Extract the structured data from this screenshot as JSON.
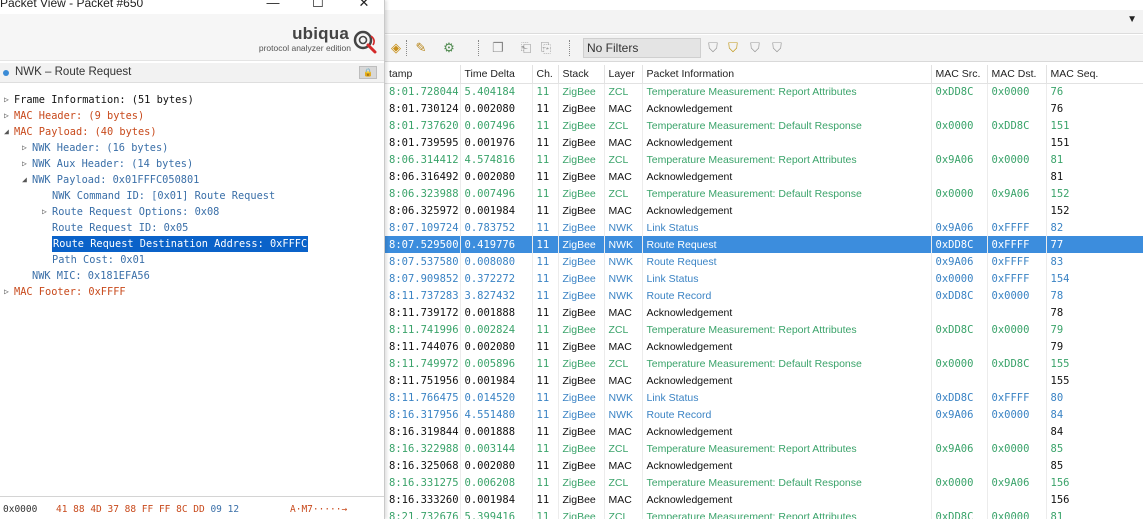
{
  "packet_view": {
    "title": "Packet View - Packet #650",
    "minimize_glyph": "—",
    "maximize_glyph": "☐",
    "close_glyph": "✕",
    "logo_text": "ubiqua",
    "logo_subtitle": "protocol analyzer edition",
    "subtitle": "NWK – Route Request",
    "tree": [
      {
        "indent": 0,
        "arrow": "▷",
        "label": "Frame Information: (51 bytes)",
        "color": "black"
      },
      {
        "indent": 0,
        "arrow": "▷",
        "label": "MAC Header: (9 bytes)",
        "color": "red"
      },
      {
        "indent": 0,
        "arrow": "◢",
        "label": "MAC Payload: (40 bytes)",
        "color": "red"
      },
      {
        "indent": 1,
        "arrow": "▷",
        "label": "NWK Header: (16 bytes)",
        "color": "blue"
      },
      {
        "indent": 1,
        "arrow": "▷",
        "label": "NWK Aux Header: (14 bytes)",
        "color": "blue"
      },
      {
        "indent": 1,
        "arrow": "◢",
        "label": "NWK Payload: 0x01FFFC050801",
        "color": "blue"
      },
      {
        "indent": 2,
        "arrow": "",
        "label": "NWK Command ID: [0x01] Route Request",
        "color": "blue"
      },
      {
        "indent": 2,
        "arrow": "▷",
        "label": "Route Request Options: 0x08",
        "color": "blue"
      },
      {
        "indent": 2,
        "arrow": "",
        "label": "Route Request ID: 0x05",
        "color": "blue"
      },
      {
        "indent": 2,
        "arrow": "",
        "label": "Route Request Destination Address: 0xFFFC",
        "color": "blue",
        "selected": true
      },
      {
        "indent": 2,
        "arrow": "",
        "label": "Path Cost: 0x01",
        "color": "blue"
      },
      {
        "indent": 1,
        "arrow": "",
        "label": "NWK MIC: 0x181EFA56",
        "color": "blue"
      },
      {
        "indent": 0,
        "arrow": "▷",
        "label": "MAC Footer: 0xFFFF",
        "color": "red"
      }
    ],
    "hex": {
      "offset": "0x0000",
      "bytes_red": "41 88 4D 37 88 FF FF 8C DD",
      "bytes_blue": "09 12",
      "ascii": "A·M7·····→"
    }
  },
  "toolbar": {
    "filter_text": "No Filters"
  },
  "packet_table": {
    "columns": [
      "tamp",
      "Time Delta",
      "Ch.",
      "Stack",
      "Layer",
      "Packet Information",
      "MAC Src.",
      "MAC Dst.",
      "MAC Seq."
    ],
    "rows": [
      {
        "ts": "8:01.728044",
        "delta": "5.404184",
        "ch": "11",
        "stack": "ZigBee",
        "layer": "ZCL",
        "info": "Temperature Measurement: Report Attributes",
        "src": "0xDD8C",
        "dst": "0x0000",
        "seq": "76",
        "kind": "zcl"
      },
      {
        "ts": "8:01.730124",
        "delta": "0.002080",
        "ch": "11",
        "stack": "ZigBee",
        "layer": "MAC",
        "info": "Acknowledgement",
        "src": "",
        "dst": "",
        "seq": "76",
        "kind": "mac"
      },
      {
        "ts": "8:01.737620",
        "delta": "0.007496",
        "ch": "11",
        "stack": "ZigBee",
        "layer": "ZCL",
        "info": "Temperature Measurement: Default Response",
        "src": "0x0000",
        "dst": "0xDD8C",
        "seq": "151",
        "kind": "zcl"
      },
      {
        "ts": "8:01.739595",
        "delta": "0.001976",
        "ch": "11",
        "stack": "ZigBee",
        "layer": "MAC",
        "info": "Acknowledgement",
        "src": "",
        "dst": "",
        "seq": "151",
        "kind": "mac"
      },
      {
        "ts": "8:06.314412",
        "delta": "4.574816",
        "ch": "11",
        "stack": "ZigBee",
        "layer": "ZCL",
        "info": "Temperature Measurement: Report Attributes",
        "src": "0x9A06",
        "dst": "0x0000",
        "seq": "81",
        "kind": "zcl"
      },
      {
        "ts": "8:06.316492",
        "delta": "0.002080",
        "ch": "11",
        "stack": "ZigBee",
        "layer": "MAC",
        "info": "Acknowledgement",
        "src": "",
        "dst": "",
        "seq": "81",
        "kind": "mac"
      },
      {
        "ts": "8:06.323988",
        "delta": "0.007496",
        "ch": "11",
        "stack": "ZigBee",
        "layer": "ZCL",
        "info": "Temperature Measurement: Default Response",
        "src": "0x0000",
        "dst": "0x9A06",
        "seq": "152",
        "kind": "zcl"
      },
      {
        "ts": "8:06.325972",
        "delta": "0.001984",
        "ch": "11",
        "stack": "ZigBee",
        "layer": "MAC",
        "info": "Acknowledgement",
        "src": "",
        "dst": "",
        "seq": "152",
        "kind": "mac"
      },
      {
        "ts": "8:07.109724",
        "delta": "0.783752",
        "ch": "11",
        "stack": "ZigBee",
        "layer": "NWK",
        "info": "Link Status",
        "src": "0x9A06",
        "dst": "0xFFFF",
        "seq": "82",
        "kind": "nwk"
      },
      {
        "ts": "8:07.529500",
        "delta": "0.419776",
        "ch": "11",
        "stack": "ZigBee",
        "layer": "NWK",
        "info": "Route Request",
        "src": "0xDD8C",
        "dst": "0xFFFF",
        "seq": "77",
        "kind": "nwk",
        "selected": true
      },
      {
        "ts": "8:07.537580",
        "delta": "0.008080",
        "ch": "11",
        "stack": "ZigBee",
        "layer": "NWK",
        "info": "Route Request",
        "src": "0x9A06",
        "dst": "0xFFFF",
        "seq": "83",
        "kind": "nwk"
      },
      {
        "ts": "8:07.909852",
        "delta": "0.372272",
        "ch": "11",
        "stack": "ZigBee",
        "layer": "NWK",
        "info": "Link Status",
        "src": "0x0000",
        "dst": "0xFFFF",
        "seq": "154",
        "kind": "nwk"
      },
      {
        "ts": "8:11.737283",
        "delta": "3.827432",
        "ch": "11",
        "stack": "ZigBee",
        "layer": "NWK",
        "info": "Route Record",
        "src": "0xDD8C",
        "dst": "0x0000",
        "seq": "78",
        "kind": "nwk"
      },
      {
        "ts": "8:11.739172",
        "delta": "0.001888",
        "ch": "11",
        "stack": "ZigBee",
        "layer": "MAC",
        "info": "Acknowledgement",
        "src": "",
        "dst": "",
        "seq": "78",
        "kind": "mac"
      },
      {
        "ts": "8:11.741996",
        "delta": "0.002824",
        "ch": "11",
        "stack": "ZigBee",
        "layer": "ZCL",
        "info": "Temperature Measurement: Report Attributes",
        "src": "0xDD8C",
        "dst": "0x0000",
        "seq": "79",
        "kind": "zcl"
      },
      {
        "ts": "8:11.744076",
        "delta": "0.002080",
        "ch": "11",
        "stack": "ZigBee",
        "layer": "MAC",
        "info": "Acknowledgement",
        "src": "",
        "dst": "",
        "seq": "79",
        "kind": "mac"
      },
      {
        "ts": "8:11.749972",
        "delta": "0.005896",
        "ch": "11",
        "stack": "ZigBee",
        "layer": "ZCL",
        "info": "Temperature Measurement: Default Response",
        "src": "0x0000",
        "dst": "0xDD8C",
        "seq": "155",
        "kind": "zcl"
      },
      {
        "ts": "8:11.751956",
        "delta": "0.001984",
        "ch": "11",
        "stack": "ZigBee",
        "layer": "MAC",
        "info": "Acknowledgement",
        "src": "",
        "dst": "",
        "seq": "155",
        "kind": "mac"
      },
      {
        "ts": "8:11.766475",
        "delta": "0.014520",
        "ch": "11",
        "stack": "ZigBee",
        "layer": "NWK",
        "info": "Link Status",
        "src": "0xDD8C",
        "dst": "0xFFFF",
        "seq": "80",
        "kind": "nwk"
      },
      {
        "ts": "8:16.317956",
        "delta": "4.551480",
        "ch": "11",
        "stack": "ZigBee",
        "layer": "NWK",
        "info": "Route Record",
        "src": "0x9A06",
        "dst": "0x0000",
        "seq": "84",
        "kind": "nwk"
      },
      {
        "ts": "8:16.319844",
        "delta": "0.001888",
        "ch": "11",
        "stack": "ZigBee",
        "layer": "MAC",
        "info": "Acknowledgement",
        "src": "",
        "dst": "",
        "seq": "84",
        "kind": "mac"
      },
      {
        "ts": "8:16.322988",
        "delta": "0.003144",
        "ch": "11",
        "stack": "ZigBee",
        "layer": "ZCL",
        "info": "Temperature Measurement: Report Attributes",
        "src": "0x9A06",
        "dst": "0x0000",
        "seq": "85",
        "kind": "zcl"
      },
      {
        "ts": "8:16.325068",
        "delta": "0.002080",
        "ch": "11",
        "stack": "ZigBee",
        "layer": "MAC",
        "info": "Acknowledgement",
        "src": "",
        "dst": "",
        "seq": "85",
        "kind": "mac"
      },
      {
        "ts": "8:16.331275",
        "delta": "0.006208",
        "ch": "11",
        "stack": "ZigBee",
        "layer": "ZCL",
        "info": "Temperature Measurement: Default Response",
        "src": "0x0000",
        "dst": "0x9A06",
        "seq": "156",
        "kind": "zcl"
      },
      {
        "ts": "8:16.333260",
        "delta": "0.001984",
        "ch": "11",
        "stack": "ZigBee",
        "layer": "MAC",
        "info": "Acknowledgement",
        "src": "",
        "dst": "",
        "seq": "156",
        "kind": "mac"
      },
      {
        "ts": "8:21.732676",
        "delta": "5.399416",
        "ch": "11",
        "stack": "ZigBee",
        "layer": "ZCL",
        "info": "Temperature Measurement: Report Attributes",
        "src": "0xDD8C",
        "dst": "0x0000",
        "seq": "81",
        "kind": "zcl"
      }
    ]
  },
  "colors": {
    "selection_row": "#3c8ddd",
    "tree_selection": "#0a62c9",
    "zcl_text": "#3aa36a",
    "nwk_text": "#3a83c4",
    "tree_red": "#c84a1c",
    "tree_blue": "#3a6fa8"
  }
}
